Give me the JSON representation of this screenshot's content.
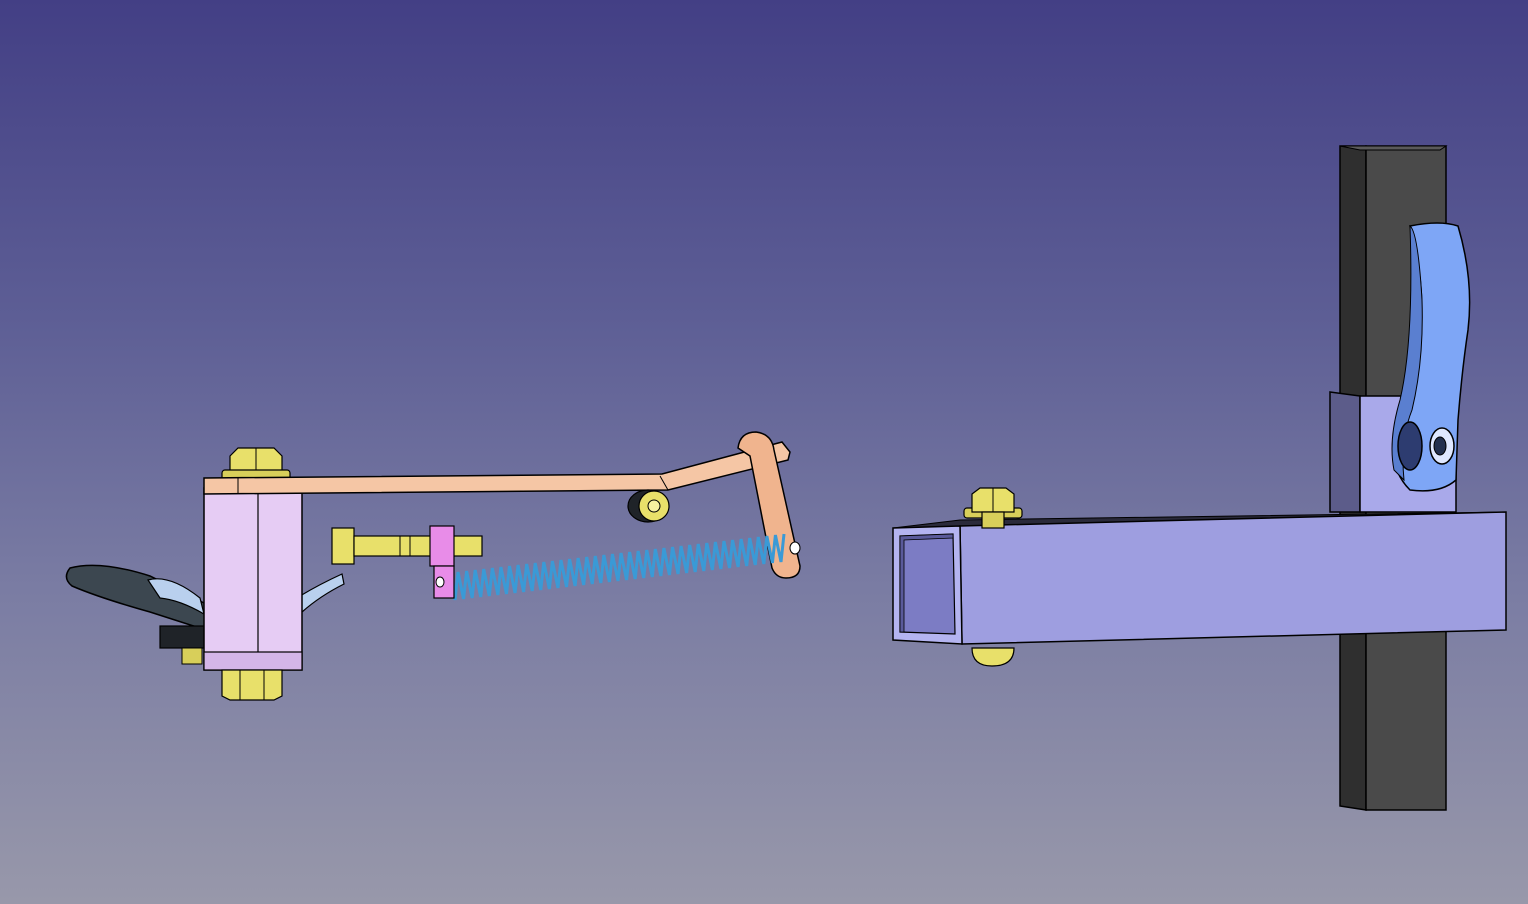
{
  "colors": {
    "background_top": "#433f85",
    "background_bottom": "#9898aa",
    "arm_color": "#f5c6a5",
    "housing_color": "#e9cdf5",
    "bolt_color": "#e8e06a",
    "spring_color": "#3a9ad6",
    "block_color": "#9e9ee0",
    "post_color": "#3a3a3a",
    "lever_color": "#7aa4f5",
    "clip_color": "#e88ce8",
    "handle_color": "#3c4750"
  },
  "icons": {
    "assembly": "mechanism-3d-model"
  }
}
